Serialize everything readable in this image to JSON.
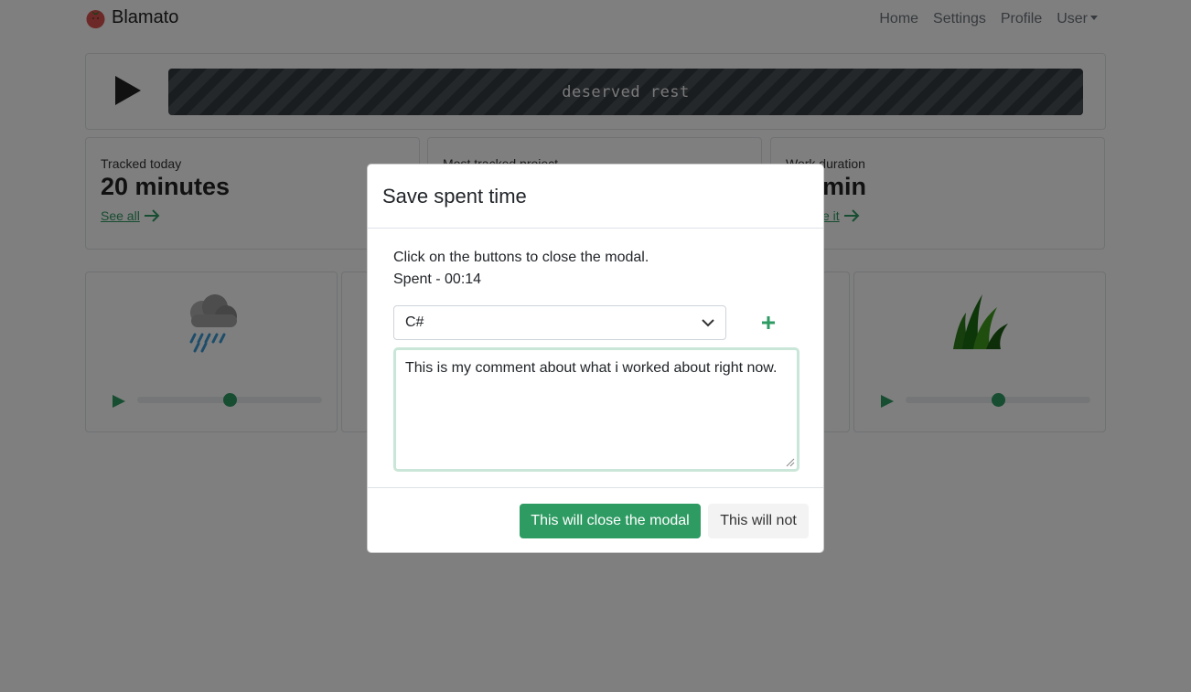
{
  "navbar": {
    "brand": "Blamato",
    "links": [
      "Home",
      "Settings",
      "Profile"
    ],
    "user_menu": "User"
  },
  "player": {
    "progress_label": "deserved rest"
  },
  "stats": [
    {
      "label": "Tracked today",
      "value": "20 minutes",
      "link": "See all"
    },
    {
      "label": "Most tracked project",
      "value": "",
      "link": ""
    },
    {
      "label": "Work duration",
      "value": "min",
      "link": "e it"
    }
  ],
  "sounds": [
    {
      "icon": "rain-cloud-icon",
      "volume": 0.5
    },
    {
      "icon": "grass-icon",
      "volume": 0.5
    }
  ],
  "modal": {
    "title": "Save spent time",
    "line1": "Click on the buttons to close the modal.",
    "line2": "Spent - 00:14",
    "project_selected": "C#",
    "comment": "This is my comment about what i worked about right now.",
    "primary_button": "This will close the modal",
    "secondary_button": "This will not"
  },
  "colors": {
    "accent": "#2e9b63",
    "backdrop": "rgba(0,0,0,0.5)"
  }
}
